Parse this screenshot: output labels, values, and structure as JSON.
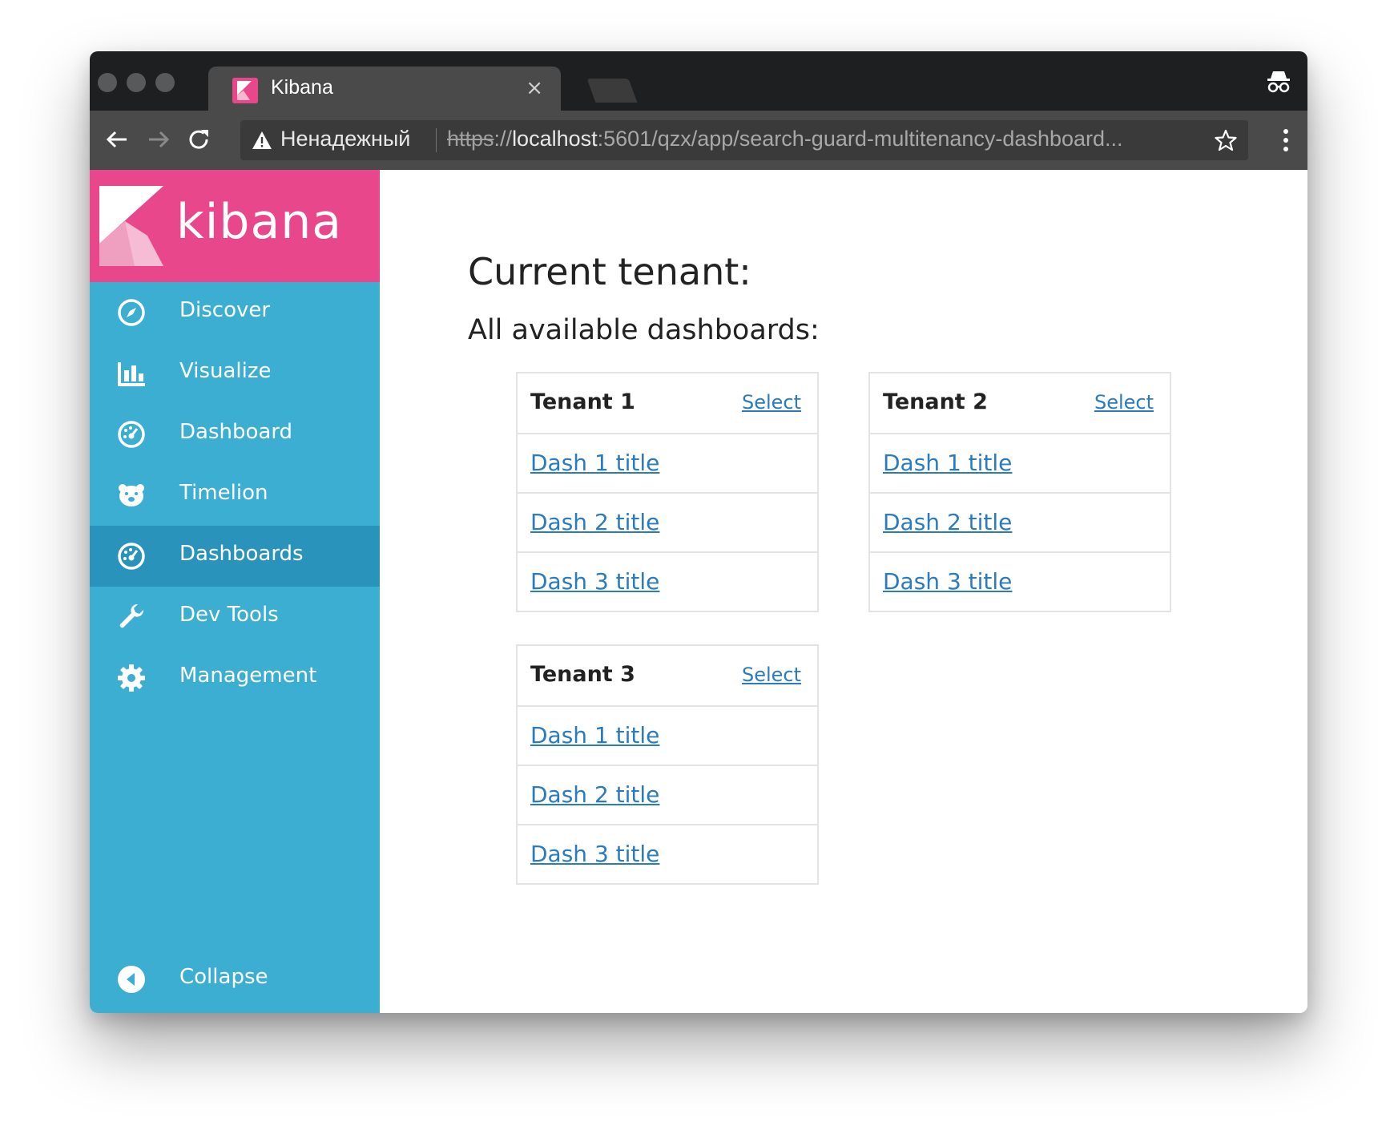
{
  "browser": {
    "tab_title": "Kibana",
    "tab_close": "×",
    "insecure_label": "Ненадежный",
    "url_scheme": "https",
    "url_sep": "://",
    "url_host": "localhost",
    "url_rest": ":5601/qzx/app/search-guard-multitenancy-dashboard..."
  },
  "sidebar": {
    "logo_text": "kibana",
    "items": [
      {
        "label": "Discover",
        "icon": "compass-icon"
      },
      {
        "label": "Visualize",
        "icon": "bar-chart-icon"
      },
      {
        "label": "Dashboard",
        "icon": "gauge-icon"
      },
      {
        "label": "Timelion",
        "icon": "bear-icon"
      },
      {
        "label": "Dashboards",
        "icon": "gauge-icon",
        "active": true
      },
      {
        "label": "Dev Tools",
        "icon": "wrench-icon"
      },
      {
        "label": "Management",
        "icon": "gear-icon"
      }
    ],
    "collapse_label": "Collapse"
  },
  "main": {
    "current_tenant_label": "Current tenant:",
    "all_dashboards_label": "All available dashboards:",
    "tenants": [
      {
        "name": "Tenant 1",
        "select_label": "Select",
        "dashboards": [
          "Dash 1 title",
          "Dash 2 title",
          "Dash 3 title"
        ]
      },
      {
        "name": "Tenant 2",
        "select_label": "Select",
        "dashboards": [
          "Dash 1 title",
          "Dash 2 title",
          "Dash 3 title"
        ]
      },
      {
        "name": "Tenant 3",
        "select_label": "Select",
        "dashboards": [
          "Dash 1 title",
          "Dash 2 title",
          "Dash 3 title"
        ]
      }
    ]
  },
  "colors": {
    "sidebar_bg": "#3caed2",
    "sidebar_active": "#2a93bb",
    "brand_pink": "#e8488b",
    "link": "#2a7bbf"
  }
}
